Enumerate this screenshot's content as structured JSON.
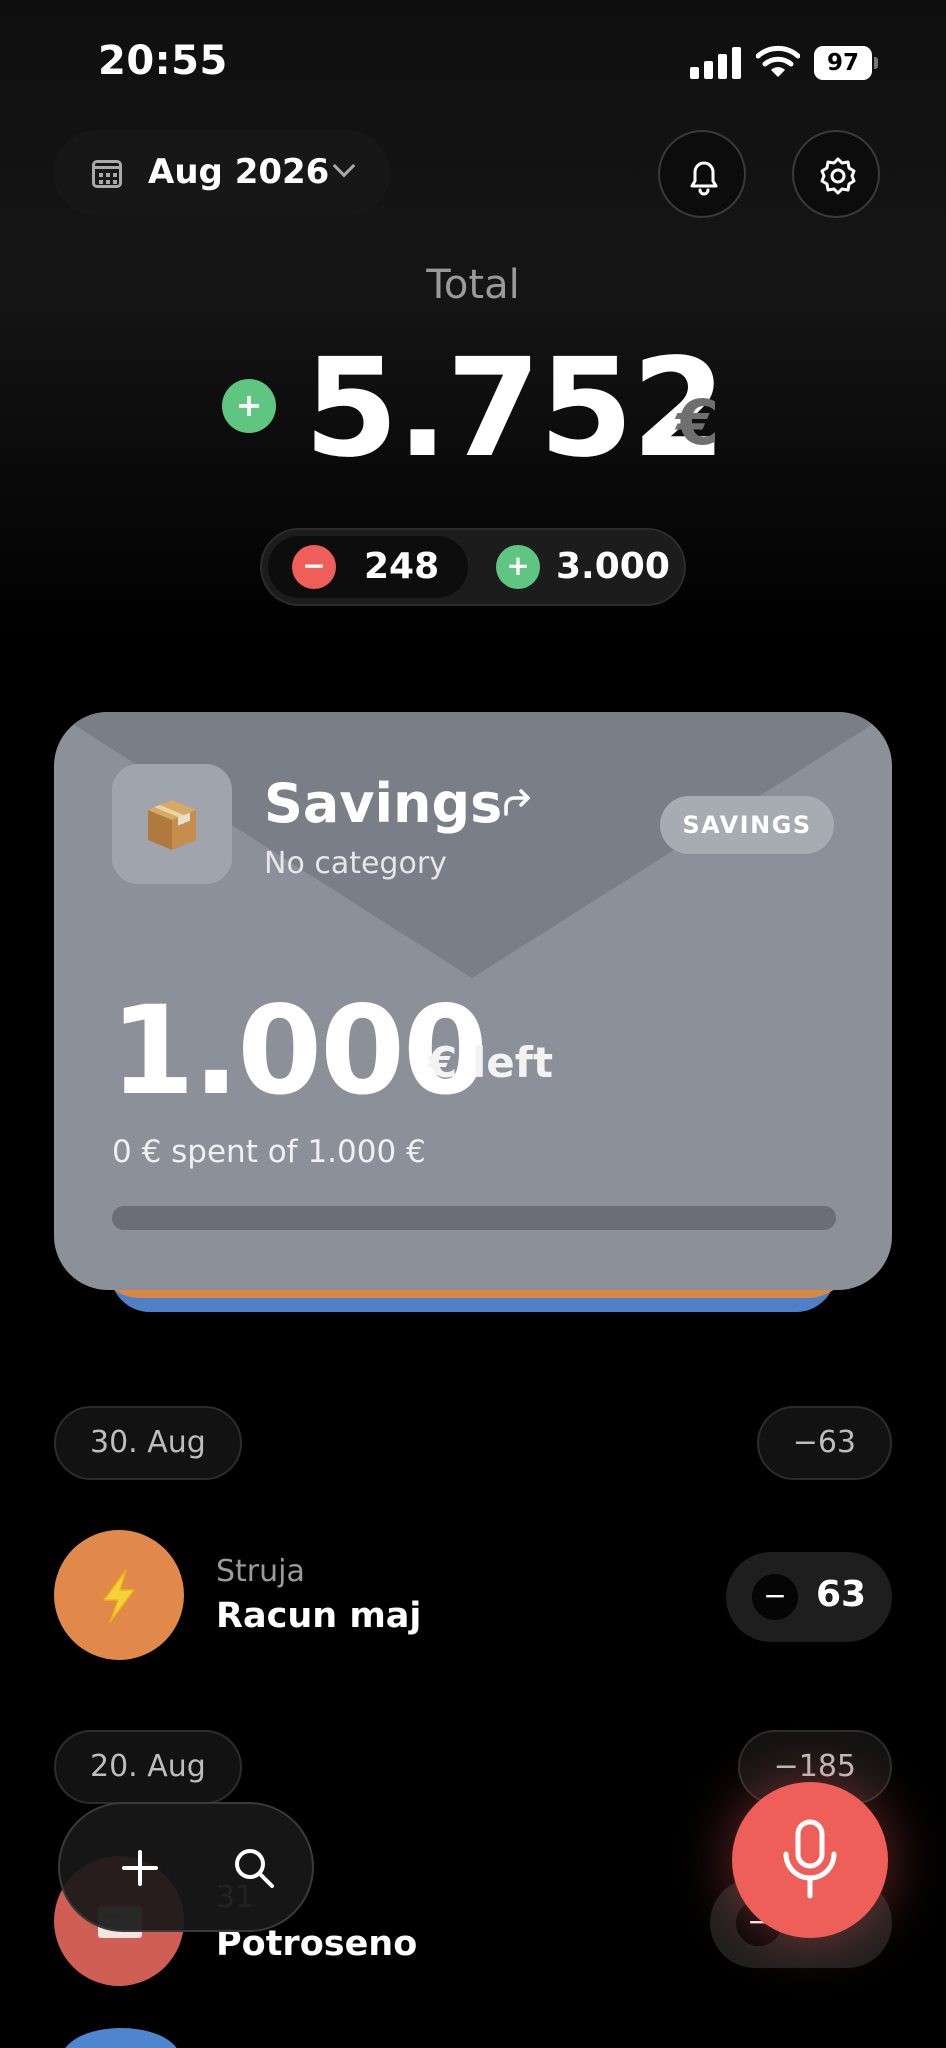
{
  "status_bar": {
    "time": "20:55",
    "battery": "97"
  },
  "header": {
    "month_label": "Aug 2026"
  },
  "total": {
    "label": "Total",
    "sign": "+",
    "value": "5.752",
    "currency": "€",
    "expense_sign": "−",
    "expense": "248",
    "income_sign": "+",
    "income": "3.000"
  },
  "budget_card": {
    "icon": "package-icon",
    "title": "Savings",
    "subtitle": "No category",
    "tag": "SAVINGS",
    "amount_left": "1.000",
    "left_label": "€ left",
    "spent_text": "0 € spent of 1.000 €",
    "progress_fraction": 0
  },
  "transactions": {
    "groups": [
      {
        "date": "30. Aug",
        "total": "−63",
        "items": [
          {
            "category": "Struja",
            "name": "Racun maj",
            "sign": "−",
            "amount": "63",
            "icon": "lightning-icon",
            "color": "#e0894a"
          }
        ]
      },
      {
        "date": "20. Aug",
        "total": "−185",
        "items": [
          {
            "category": "31",
            "name": "Potroseno",
            "sign": "−",
            "amount": "",
            "icon": "receipt-icon",
            "color": "#cf5e55"
          }
        ]
      }
    ]
  },
  "colors": {
    "income": "#5fc682",
    "expense": "#ee5f5a",
    "card": "#8c9099",
    "stack_orange": "#d98743",
    "stack_blue": "#4e7fc7"
  }
}
